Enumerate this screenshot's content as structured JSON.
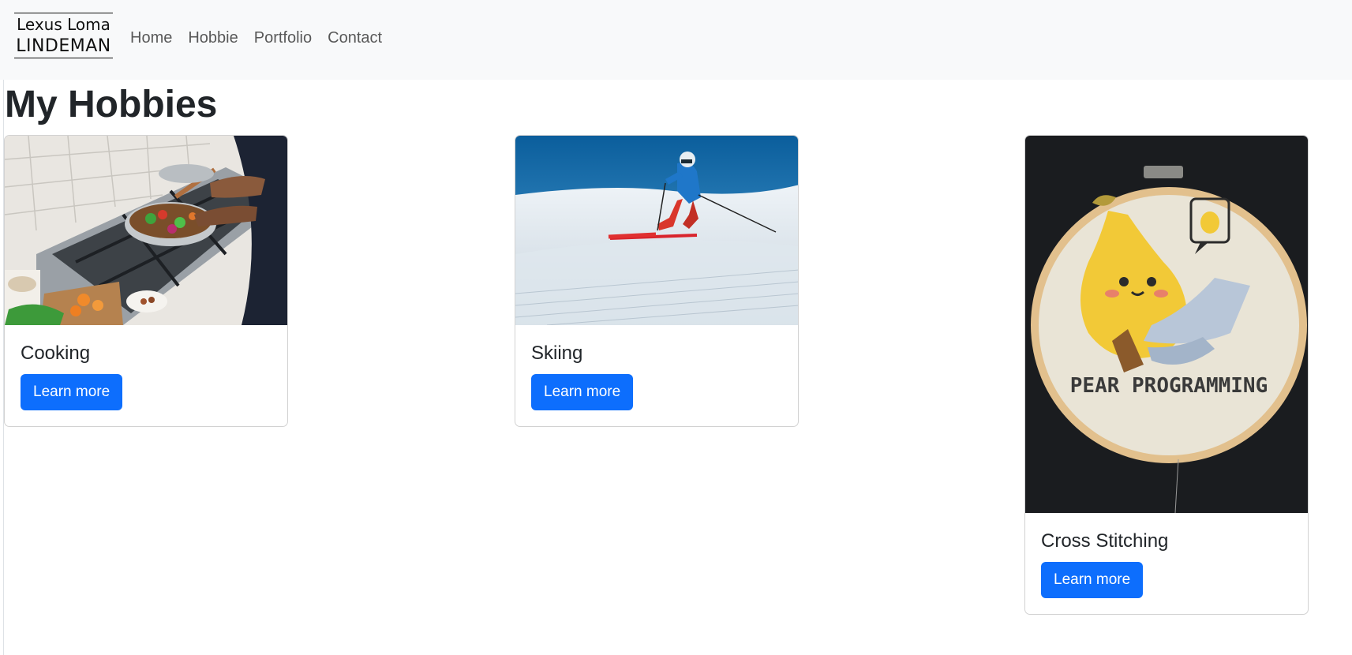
{
  "brand": {
    "line1": "Lexus Loma",
    "line2": "LINDEMAN"
  },
  "nav": {
    "items": [
      "Home",
      "Hobbie",
      "Portfolio",
      "Contact"
    ]
  },
  "page": {
    "title": "My Hobbies"
  },
  "cards": [
    {
      "title": "Cooking",
      "button": "Learn more"
    },
    {
      "title": "Skiing",
      "button": "Learn more"
    },
    {
      "title": "Cross Stitching",
      "button": "Learn more",
      "image_text": "PEAR PROGRAMMING"
    }
  ],
  "colors": {
    "primary": "#0d6efd",
    "navbar_bg": "#f8f9fa",
    "text": "#212529"
  }
}
